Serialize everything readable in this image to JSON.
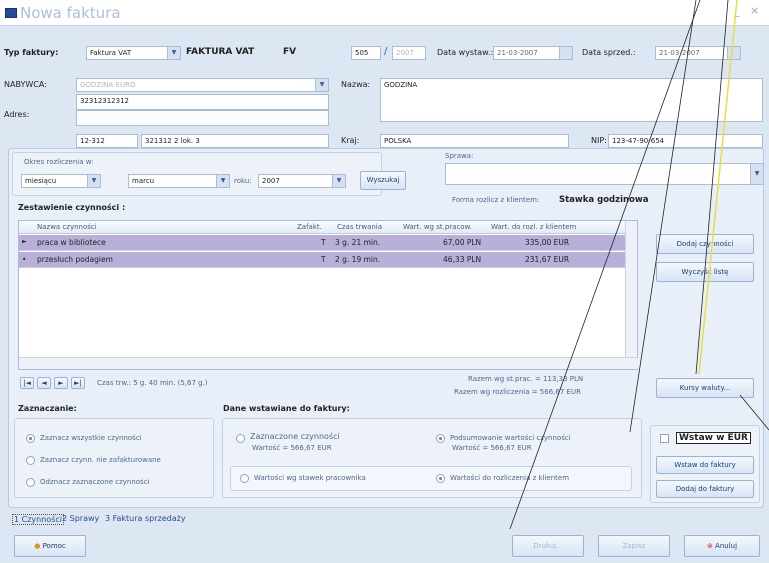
{
  "window": {
    "title": "Nowa faktura",
    "min_icon": "minimize-icon",
    "close_icon": "close-icon"
  },
  "header": {
    "type_label": "Typ faktury:",
    "type_value": "Faktura VAT",
    "type_bold": "FAKTURA VAT",
    "type_code": "FV",
    "number": "505",
    "slash": "/",
    "year": "2007",
    "issue_date_label": "Data wystaw.:",
    "issue_date": "21-03-2007",
    "sale_date_label": "Data sprzed.:",
    "sale_date": "21-03-2007"
  },
  "buyer": {
    "label": "NABYWCA:",
    "select_value": "GODZINA-EURO",
    "address_label": "Adres:",
    "address_line1": "32312312312",
    "postal": "12-312",
    "street": "321312 2 lok. 3",
    "name_label": "Nazwa:",
    "name_value": "GODZINA",
    "country_label": "Kraj:",
    "country_value": "POLSKA",
    "nip_label": "NIP:",
    "nip_value": "123-47-90-654"
  },
  "period": {
    "label": "Okres rozliczenia w:",
    "unit": "miesiącu",
    "month": "marcu",
    "year_label": "roku:",
    "year": "2007",
    "search_button": "Wyszukaj",
    "case_label": "Sprawa:",
    "settle_label": "Forma rozlicz z klientem:",
    "settle_value": "Stawka godzinowa"
  },
  "summary_title": "Zestawienie czynności :",
  "grid": {
    "columns": [
      "Nazwa czynności",
      "Zafakt.",
      "Czas trwania",
      "Wart. wg st.pracow.",
      "Wart. do rozl. z klientem"
    ],
    "rows": [
      {
        "marker": "►",
        "name": "praca w bibliotece",
        "flag": "T",
        "time": "3 g. 21 min.",
        "val1": "67,00 PLN",
        "val2": "335,00 EUR"
      },
      {
        "marker": "•",
        "name": "przesłuch podagiem",
        "flag": "T",
        "time": "2 g. 19 min.",
        "val1": "46,33 PLN",
        "val2": "231,67 EUR"
      }
    ]
  },
  "nav": {
    "total_label": "Czas trw.: 5 g. 40 min. (5,67 g.)",
    "sum_line1": "Razem wg st.prac. = 113,33 PLN",
    "sum_line2": "Razem wg rozliczenia = 566,67 EUR"
  },
  "right_buttons": {
    "add": "Dodaj czynności",
    "clear": "Wyczyść listę",
    "rates": "Kursy waluty..."
  },
  "marking": {
    "title": "Zaznaczanie:",
    "opt1": "Zaznacz wszystkie czynności",
    "opt2": "Zaznacz czynn. nie zafakturowane",
    "opt3": "Odznacz zaznaczone czynności"
  },
  "insert": {
    "title": "Dane wstawiane do faktury:",
    "a1": "Zaznaczone czynności",
    "a1s": "Wartość = 566,67 EUR",
    "a2": "Podsumowanie wartości czynności",
    "a2s": "Wartość = 566,67 EUR",
    "b1": "Wartości wg stawek pracownika",
    "b2": "Wartości do rozliczenia z klientem"
  },
  "euro": {
    "checkbox": "Wstaw w EUR",
    "insert_btn": "Wstaw do faktury",
    "add_btn": "Dodaj do faktury"
  },
  "tabs": [
    "1 Czynności",
    "2 Sprawy",
    "3 Faktura sprzedaży"
  ],
  "footer": {
    "help": "Pomoc",
    "print": "Drukuj...",
    "save": "Zapisz",
    "cancel": "Anuluj"
  }
}
